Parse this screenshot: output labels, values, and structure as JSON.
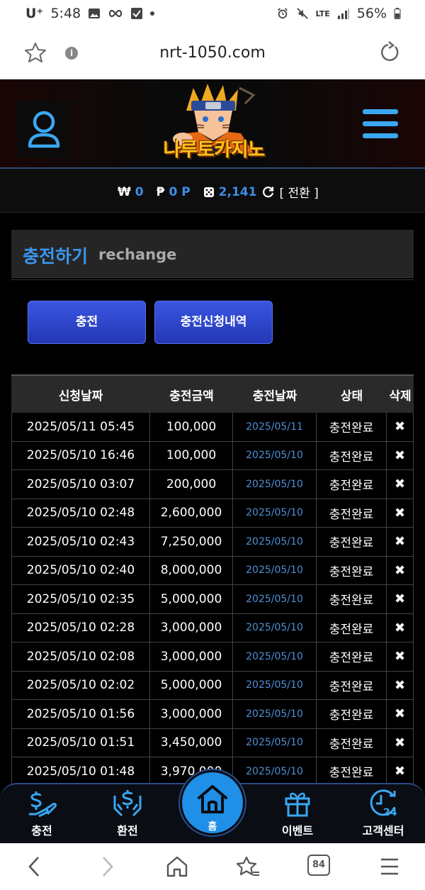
{
  "status_bar": {
    "carrier": "U⁺",
    "time": "5:48",
    "battery": "56%",
    "network": "LTE"
  },
  "browser": {
    "url": "nrt-1050.com"
  },
  "site": {
    "logo_text": "나루토카지노"
  },
  "balance": {
    "won_symbol": "₩",
    "won_value": "0",
    "point_symbol": "₱",
    "point_value": "0 P",
    "chip_value": "2,141",
    "convert_label": "[ 전환 ]"
  },
  "section": {
    "title_ko": "충전하기",
    "title_en": "rechange"
  },
  "tabs": {
    "charge": "충전",
    "history": "충전신청내역"
  },
  "table": {
    "headers": [
      "신청날짜",
      "충전금액",
      "충전날짜",
      "상태",
      "삭제"
    ],
    "delete_symbol": "✖",
    "rows": [
      {
        "request": "2025/05/11 05:45",
        "amount": "100,000",
        "date": "2025/05/11",
        "status": "충전완료"
      },
      {
        "request": "2025/05/10 16:46",
        "amount": "100,000",
        "date": "2025/05/10",
        "status": "충전완료"
      },
      {
        "request": "2025/05/10 03:07",
        "amount": "200,000",
        "date": "2025/05/10",
        "status": "충전완료"
      },
      {
        "request": "2025/05/10 02:48",
        "amount": "2,600,000",
        "date": "2025/05/10",
        "status": "충전완료"
      },
      {
        "request": "2025/05/10 02:43",
        "amount": "7,250,000",
        "date": "2025/05/10",
        "status": "충전완료"
      },
      {
        "request": "2025/05/10 02:40",
        "amount": "8,000,000",
        "date": "2025/05/10",
        "status": "충전완료"
      },
      {
        "request": "2025/05/10 02:35",
        "amount": "5,000,000",
        "date": "2025/05/10",
        "status": "충전완료"
      },
      {
        "request": "2025/05/10 02:28",
        "amount": "3,000,000",
        "date": "2025/05/10",
        "status": "충전완료"
      },
      {
        "request": "2025/05/10 02:08",
        "amount": "3,000,000",
        "date": "2025/05/10",
        "status": "충전완료"
      },
      {
        "request": "2025/05/10 02:02",
        "amount": "5,000,000",
        "date": "2025/05/10",
        "status": "충전완료"
      },
      {
        "request": "2025/05/10 01:56",
        "amount": "3,000,000",
        "date": "2025/05/10",
        "status": "충전완료"
      },
      {
        "request": "2025/05/10 01:51",
        "amount": "3,450,000",
        "date": "2025/05/10",
        "status": "충전완료"
      },
      {
        "request": "2025/05/10 01:48",
        "amount": "3,970,000",
        "date": "2025/05/10",
        "status": "충전완료"
      }
    ]
  },
  "bottom_nav": {
    "charge": "충전",
    "exchange": "환전",
    "home": "홈",
    "event": "이벤트",
    "support": "고객센터"
  },
  "android_nav": {
    "tabs_count": "84"
  },
  "colors": {
    "accent_blue": "#3a95ee",
    "button_blue": "#2f47d0",
    "date_blue": "#4e8fd6",
    "logo_yellow": "#ffc21a"
  }
}
